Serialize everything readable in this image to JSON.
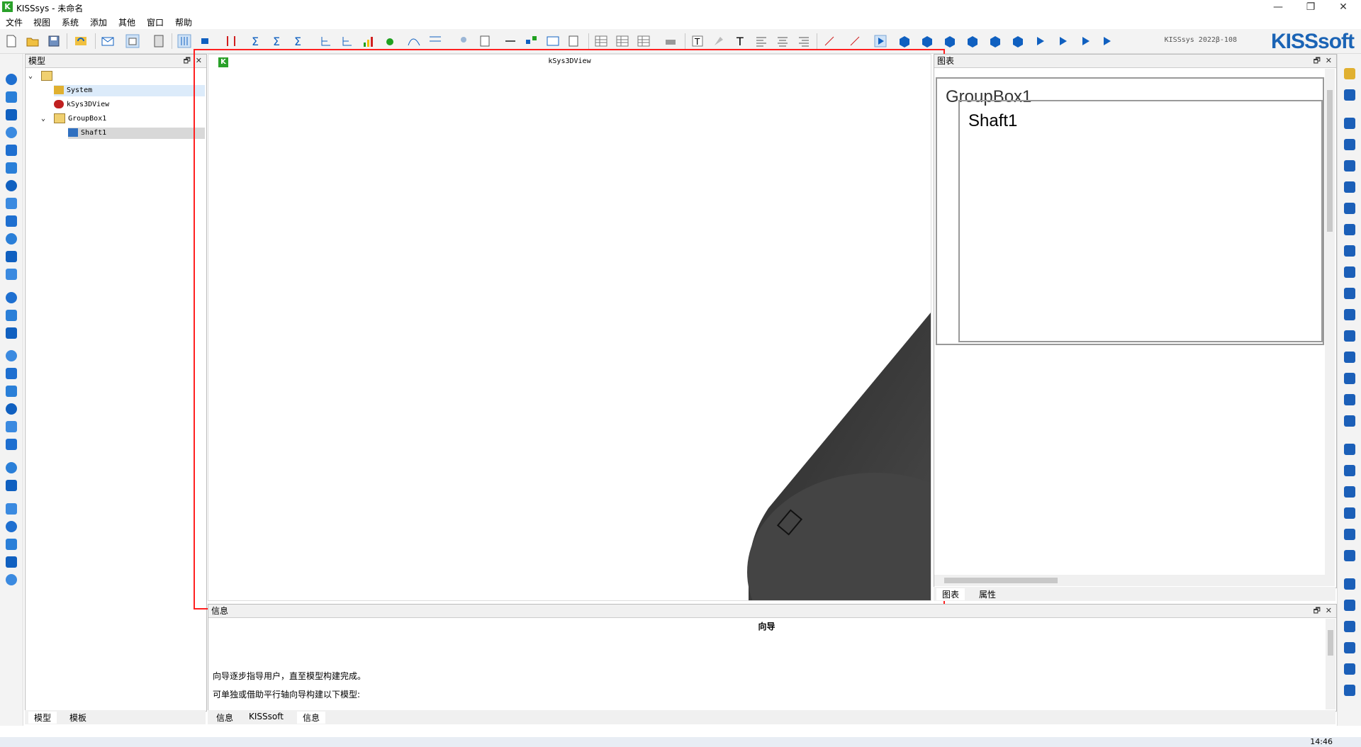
{
  "window": {
    "app_title": "KISSsys - 未命名",
    "app_logo_text": "K",
    "minimize": "—",
    "maximize": "❐",
    "close": "✕"
  },
  "menu": [
    "文件",
    "视图",
    "系统",
    "添加",
    "其他",
    "窗口",
    "帮助"
  ],
  "toolbar": {
    "version": "KISSsys 2022β-108",
    "brand": "KISSsoft"
  },
  "model_panel": {
    "title": "模型",
    "tree": [
      {
        "label": "",
        "icon": "folder-icon"
      },
      {
        "label": "System",
        "icon": "system-icon"
      },
      {
        "label": "kSys3DView",
        "icon": "eye-icon"
      },
      {
        "label": "GroupBox1",
        "icon": "folder-icon"
      },
      {
        "label": "Shaft1",
        "icon": "shaft-icon"
      }
    ],
    "tabs": [
      "模型",
      "模板"
    ]
  },
  "view3d": {
    "title": "kSys3DView",
    "icon_text": "K"
  },
  "diagram_panel": {
    "title": "图表",
    "group_label": "GroupBox1",
    "shaft_label": "Shaft1",
    "tabs": [
      "图表",
      "属性"
    ]
  },
  "info_panel": {
    "title": "信息",
    "heading": "向导",
    "line1": "向导逐步指导用户，直至模型构建完成。",
    "line2": "可单独或借助平行轴向导构建以下模型:",
    "tabs": [
      "信息",
      "KISSsoft",
      "信息"
    ]
  },
  "taskbar": {
    "time": "14:46"
  },
  "colors": {
    "accent_red": "#ff2020",
    "brand_blue": "#1b64b5",
    "shaft_dark": "#3a3a3a"
  }
}
